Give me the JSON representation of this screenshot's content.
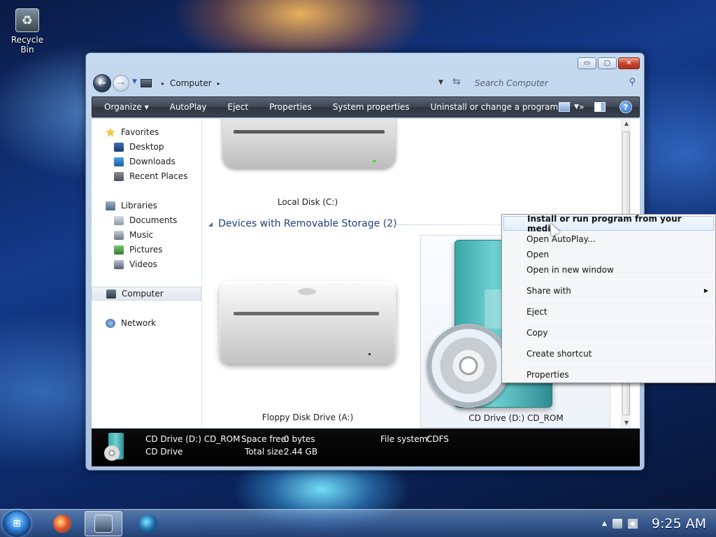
{
  "desktop": {
    "icons": [
      {
        "label": "Recycle Bin",
        "icon": "recycle-bin-icon"
      }
    ]
  },
  "window": {
    "title_buttons": {
      "minimize": "▭",
      "maximize": "▢",
      "close": "✕"
    },
    "address": {
      "path": [
        "Computer"
      ],
      "sep": "▸",
      "search_placeholder": "Search Computer"
    },
    "toolbar": {
      "items": [
        "Organize ▾",
        "AutoPlay",
        "Eject",
        "Properties",
        "System properties",
        "Uninstall or change a program",
        "»"
      ]
    },
    "nav_pane": {
      "favorites": {
        "label": "Favorites",
        "items": [
          "Desktop",
          "Downloads",
          "Recent Places"
        ]
      },
      "libraries": {
        "label": "Libraries",
        "items": [
          "Documents",
          "Music",
          "Pictures",
          "Videos"
        ]
      },
      "computer": "Computer",
      "network": "Network"
    },
    "files": {
      "hard_disk_label": "Local Disk (C:)",
      "removable_group": "Devices with Removable Storage (2)",
      "floppy_label": "Floppy Disk Drive (A:)",
      "cd_label": "CD Drive (D:) CD_ROM"
    },
    "details": {
      "name": "CD Drive (D:) CD_ROM",
      "type": "CD Drive",
      "space_free_label": "Space free:",
      "space_free": "0 bytes",
      "total_size_label": "Total size:",
      "total_size": "2.44 GB",
      "filesystem_label": "File system:",
      "filesystem": "CDFS"
    }
  },
  "context_menu": {
    "items": [
      {
        "label": "Install or run program from your media",
        "highlighted": true
      },
      {
        "label": "Open AutoPlay..."
      },
      {
        "label": "Open"
      },
      {
        "label": "Open in new window"
      },
      {
        "label": "Share with",
        "submenu": true
      },
      {
        "label": "Eject"
      },
      {
        "label": "Copy"
      },
      {
        "label": "Create shortcut"
      },
      {
        "label": "Properties"
      }
    ],
    "submenu_arrow": "▶"
  },
  "taskbar": {
    "clock": "9:25 AM",
    "tray_arrow": "▲",
    "apps": [
      "media-center-icon",
      "explorer-drive-icon",
      "media-player-icon"
    ]
  },
  "colors": {
    "toolbar_bg": "#3e4654",
    "highlight": "#e3eefa",
    "details_bg": "#000000"
  }
}
